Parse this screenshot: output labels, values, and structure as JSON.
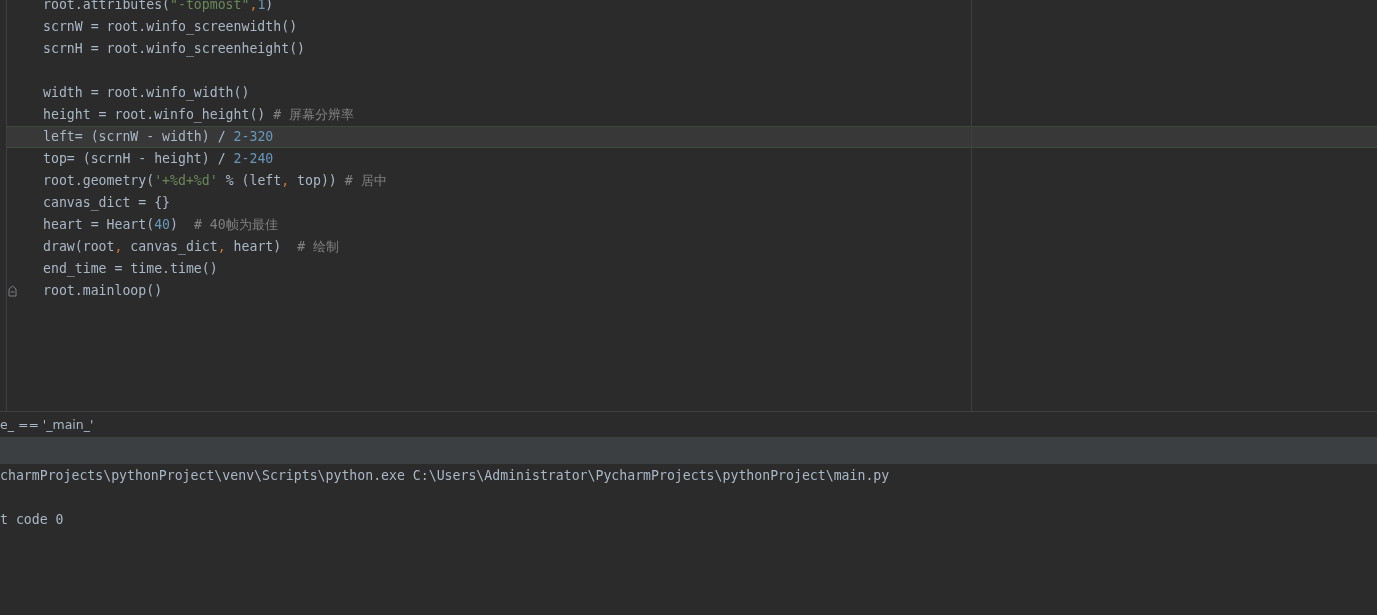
{
  "editor": {
    "lines": [
      {
        "current": false,
        "fold_marker": false,
        "tokens": [
          {
            "kind": "plain",
            "text": "root.attributes("
          },
          {
            "kind": "string",
            "text": "\"-topmost\""
          },
          {
            "kind": "punct",
            "text": ","
          },
          {
            "kind": "number",
            "text": "1"
          },
          {
            "kind": "plain",
            "text": ")"
          }
        ]
      },
      {
        "current": false,
        "fold_marker": false,
        "tokens": [
          {
            "kind": "plain",
            "text": "scrnW = root.winfo_screenwidth()"
          }
        ]
      },
      {
        "current": false,
        "fold_marker": false,
        "tokens": [
          {
            "kind": "plain",
            "text": "scrnH = root.winfo_screenheight()"
          }
        ]
      },
      {
        "current": false,
        "fold_marker": false
      },
      {
        "current": false,
        "fold_marker": false,
        "tokens": [
          {
            "kind": "plain",
            "text": "width = root.winfo_width()"
          }
        ]
      },
      {
        "current": false,
        "fold_marker": false,
        "tokens": [
          {
            "kind": "plain",
            "text": "height = root.winfo_height() "
          },
          {
            "kind": "comment",
            "text": "# 屏幕分辨率"
          }
        ]
      },
      {
        "current": true,
        "fold_marker": false,
        "tokens": [
          {
            "kind": "plain",
            "text": "left= (scrnW - width) / "
          },
          {
            "kind": "number",
            "text": "2-320"
          }
        ]
      },
      {
        "current": false,
        "fold_marker": false,
        "tokens": [
          {
            "kind": "plain",
            "text": "top= (scrnH - height) / "
          },
          {
            "kind": "number",
            "text": "2-240"
          }
        ]
      },
      {
        "current": false,
        "fold_marker": false,
        "tokens": [
          {
            "kind": "plain",
            "text": "root.geometry("
          },
          {
            "kind": "string",
            "text": "'+%d+%d'"
          },
          {
            "kind": "plain",
            "text": " % (left"
          },
          {
            "kind": "punct",
            "text": ","
          },
          {
            "kind": "plain",
            "text": " top)) "
          },
          {
            "kind": "comment",
            "text": "# 居中"
          }
        ]
      },
      {
        "current": false,
        "fold_marker": false,
        "tokens": [
          {
            "kind": "plain",
            "text": "canvas_dict = {}"
          }
        ]
      },
      {
        "current": false,
        "fold_marker": false,
        "tokens": [
          {
            "kind": "plain",
            "text": "heart = Heart("
          },
          {
            "kind": "number",
            "text": "40"
          },
          {
            "kind": "plain",
            "text": ")  "
          },
          {
            "kind": "comment",
            "text": "# 40帧为最佳"
          }
        ]
      },
      {
        "current": false,
        "fold_marker": false,
        "tokens": [
          {
            "kind": "plain",
            "text": "draw(root"
          },
          {
            "kind": "punct",
            "text": ","
          },
          {
            "kind": "plain",
            "text": " canvas_dict"
          },
          {
            "kind": "punct",
            "text": ","
          },
          {
            "kind": "plain",
            "text": " heart)  "
          },
          {
            "kind": "comment",
            "text": "# 绘制"
          }
        ]
      },
      {
        "current": false,
        "fold_marker": false,
        "tokens": [
          {
            "kind": "plain",
            "text": "end_time = time.time()"
          }
        ]
      },
      {
        "current": false,
        "fold_marker": true,
        "tokens": [
          {
            "kind": "plain",
            "text": "root.mainloop()"
          }
        ]
      }
    ]
  },
  "breadcrumb": "e_ == '_main_'",
  "console": {
    "lines": [
      "charmProjects\\pythonProject\\venv\\Scripts\\python.exe C:\\Users\\Administrator\\PycharmProjects\\pythonProject\\main.py",
      "t code 0"
    ]
  }
}
